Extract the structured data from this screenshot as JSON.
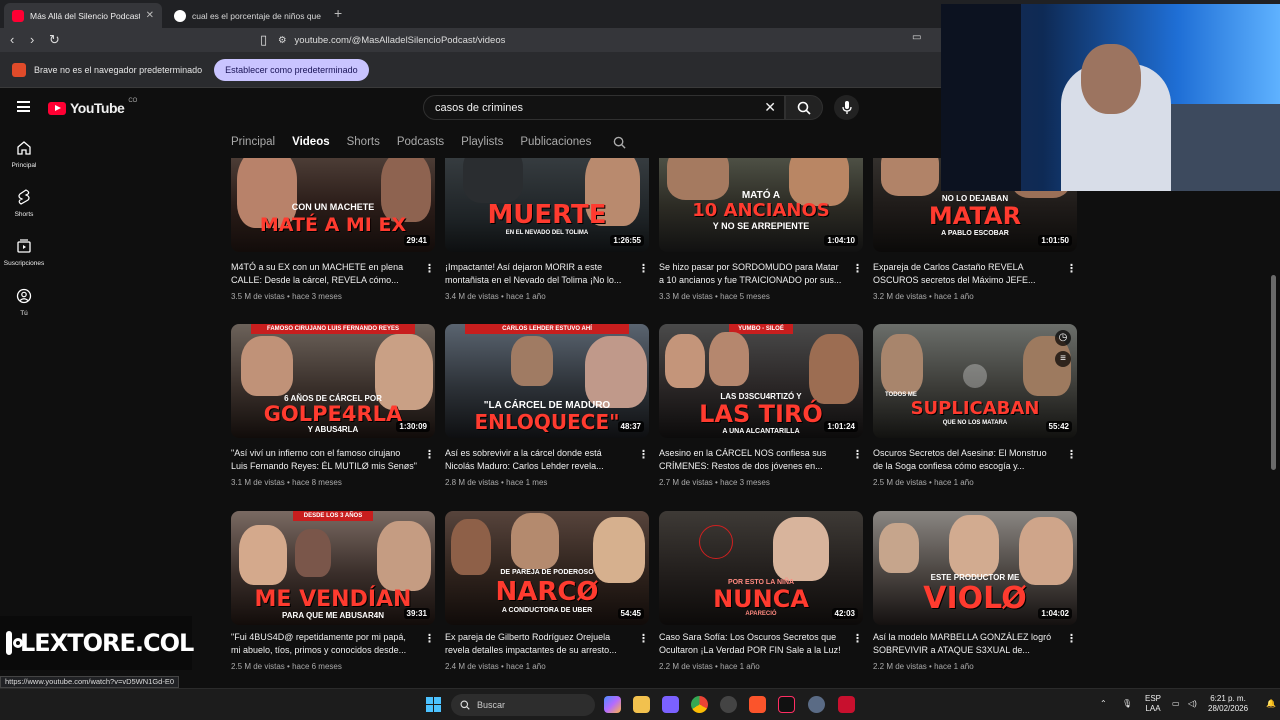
{
  "browser": {
    "tabs": [
      {
        "label": "Más Allá del Silencio Podcast - Y",
        "active": true
      },
      {
        "label": "cual es el porcentaje de niños que cr",
        "active": false
      }
    ],
    "url": "youtube.com/@MasAlladelSilencioPodcast/videos",
    "infobar": {
      "message": "Brave no es el navegador predeterminado",
      "button": "Establecer como predeterminado"
    }
  },
  "header": {
    "logo": "YouTube",
    "country": "CO",
    "search_value": "casos de crimines"
  },
  "channel_tabs": [
    "Principal",
    "Videos",
    "Shorts",
    "Podcasts",
    "Playlists",
    "Publicaciones"
  ],
  "active_tab": "Videos",
  "rail": [
    {
      "label": "Principal",
      "icon": "home-icon"
    },
    {
      "label": "Shorts",
      "icon": "shorts-icon"
    },
    {
      "label": "Suscripciones",
      "icon": "subscriptions-icon"
    },
    {
      "label": "Tú",
      "icon": "you-icon"
    }
  ],
  "videos": [
    {
      "title": "M4TÓ a su EX con un MACHETE en plena CALLE: Desde la cárcel, REVELA cómo...",
      "views": "3.5 M de vistas",
      "age": "hace 3 meses",
      "duration": "29:41",
      "thumb_text": "MATÉ A MI EX",
      "thumb_sub": "CON UN MACHETE"
    },
    {
      "title": "¡Impactante! Así dejaron MORIR a este montañista en el Nevado del Tolima ¡No lo...",
      "views": "3.4 M de vistas",
      "age": "hace 1 año",
      "duration": "1:26:55",
      "thumb_text": "MUERTE",
      "thumb_sub": "EN EL NEVADO DEL TOLIMA"
    },
    {
      "title": "Se hizo pasar por SORDOMUDO para Matar a 10 ancianos y fue TRAICIONADO por sus...",
      "views": "3.3 M de vistas",
      "age": "hace 5 meses",
      "duration": "1:04:10",
      "thumb_text": "10 ANCIANOS",
      "thumb_sub": "MATÓ A",
      "thumb_sub2": "Y NO SE ARREPIENTE"
    },
    {
      "title": "Expareja de Carlos Castaño REVELA OSCUROS secretos del Máximo JEFE...",
      "views": "3.2 M de vistas",
      "age": "hace 1 año",
      "duration": "1:01:50",
      "thumb_text": "MATAR",
      "thumb_sub": "NO LO DEJABAN",
      "thumb_sub2": "A PABLO ESCOBAR"
    },
    {
      "title": "\"Así viví un infierno con el famoso cirujano Luis Fernando Reyes: ÉL MUTILØ mis Senøs\"",
      "views": "3.1 M de vistas",
      "age": "hace 8 meses",
      "duration": "1:30:09",
      "thumb_text": "GOLPE4RLA",
      "thumb_sub": "6 AÑOS DE CÁRCEL POR",
      "thumb_sub2": "Y ABUS4RLA",
      "banner": "FAMOSO CIRUJANO LUIS FERNANDO REYES"
    },
    {
      "title": "Así es sobrevivir a la cárcel donde está Nicolás Maduro: Carlos Lehder revela...",
      "views": "2.8 M de vistas",
      "age": "hace 1 mes",
      "duration": "48:37",
      "thumb_text": "ENLOQUECE\"",
      "thumb_sub": "\"LA CÁRCEL DE MADURO",
      "banner": "CARLOS LEHDER ESTUVO AHÍ"
    },
    {
      "title": "Asesino en la CÁRCEL NOS confiesa sus CRÍMENES: Restos de dos jóvenes en...",
      "views": "2.7 M de vistas",
      "age": "hace 3 meses",
      "duration": "1:01:24",
      "thumb_text": "LAS TIRÓ",
      "thumb_sub": "LAS D3SCU4RTIZÓ Y",
      "thumb_sub2": "A UNA ALCANTARILLA",
      "banner": "YUMBO - SILOÉ"
    },
    {
      "title": "Oscuros Secretos del Asesinø: El Monstruo de la Soga confiesa cómo escogía y...",
      "views": "2.5 M de vistas",
      "age": "hace 1 año",
      "duration": "55:42",
      "thumb_text": "SUPLICABAN",
      "thumb_sub": "TODOS ME",
      "thumb_sub2": "QUE NO LOS MATARA"
    },
    {
      "title": "\"Fui 4BUS4D@ repetidamente por mi papá, mi abuelo, tíos, primos y conocidos desde...",
      "views": "2.5 M de vistas",
      "age": "hace 6 meses",
      "duration": "39:31",
      "thumb_text": "ME VENDÍAN",
      "thumb_sub2": "PARA QUE ME ABUSAR4N",
      "banner": "DESDE LOS 3 AÑOS"
    },
    {
      "title": "Ex pareja de Gilberto Rodríguez Orejuela revela detalles impactantes de su arresto...",
      "views": "2.4 M de vistas",
      "age": "hace 1 año",
      "duration": "54:45",
      "thumb_text": "NARCØ",
      "thumb_sub": "DE PAREJA DE PODEROSO",
      "thumb_sub2": "A CONDUCTORA DE UBER"
    },
    {
      "title": "Caso Sara Sofía: Los Oscuros Secretos que Ocultaron ¡La Verdad POR FIN Sale a la Luz!",
      "views": "2.2 M de vistas",
      "age": "hace 1 año",
      "duration": "42:03",
      "thumb_text": "NUNCA",
      "thumb_sub": "POR ESTO LA NIÑA",
      "thumb_sub2": "APARECIÓ"
    },
    {
      "title": "Así la modelo MARBELLA GONZÁLEZ logró SOBREVIVIR a ATAQUE S3XUAL de...",
      "views": "2.2 M de vistas",
      "age": "hace 1 año",
      "duration": "1:04:02",
      "thumb_text": "VIOLØ",
      "thumb_sub": "ESTE PRODUCTOR ME"
    }
  ],
  "overlay": {
    "instagram_handle": "LEXTORE.COL",
    "status_url": "https://www.youtube.com/watch?v=vD5WN1Gd-E0"
  },
  "taskbar": {
    "search_placeholder": "Buscar",
    "lang": "ESP",
    "lang2": "LAA",
    "time": "6:21 p. m.",
    "date": "28/02/2026"
  },
  "colors": {
    "yt_red": "#ff0033",
    "thumb_red": "#ff3b2f",
    "accent_button": "#c9c4ff"
  }
}
